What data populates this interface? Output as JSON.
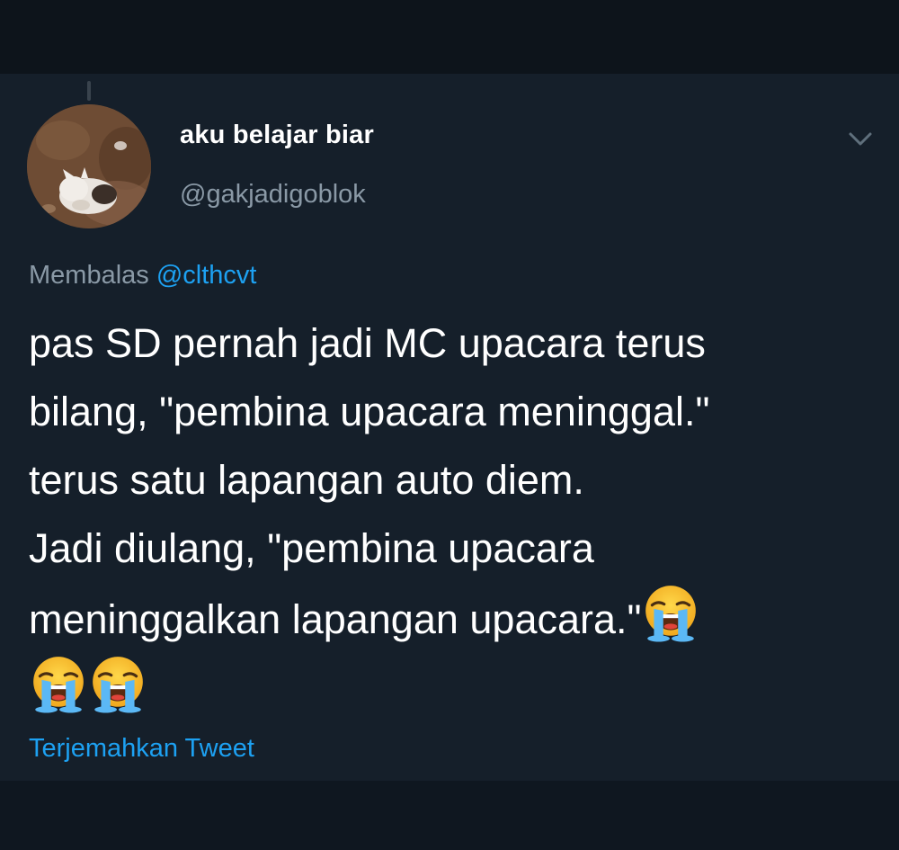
{
  "tweet": {
    "display_name": "aku belajar biar",
    "handle": "@gakjadigoblok",
    "reply_prefix": "Membalas",
    "reply_to": "@clthcvt",
    "lines": [
      "pas SD pernah jadi MC upacara terus",
      "bilang, \"pembina upacara meninggal.\"",
      "terus satu lapangan auto diem.",
      "Jadi diulang, \"pembina upacara",
      "meninggalkan lapangan upacara.\""
    ],
    "emoji_name": "loudly-crying-face-emoji",
    "translate_label": "Terjemahkan Tweet",
    "menu_icon": "chevron-down-icon",
    "avatar_icon": "cat-avatar-icon"
  },
  "colors": {
    "background": "#151f2a",
    "text": "#ffffff",
    "muted": "#8a99a6",
    "link": "#1da1f2"
  }
}
